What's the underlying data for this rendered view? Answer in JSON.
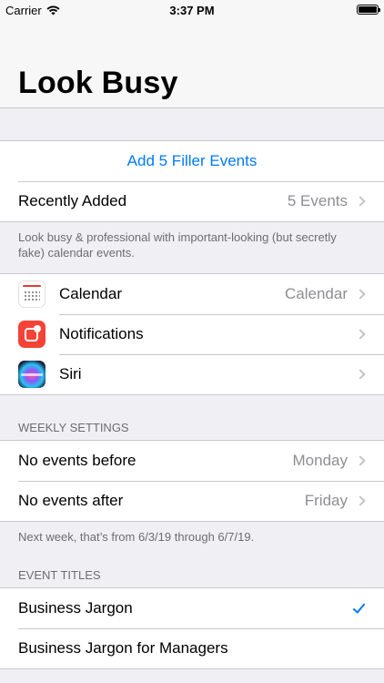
{
  "status": {
    "carrier": "Carrier",
    "time": "3:37 PM"
  },
  "nav": {
    "title": "Look Busy"
  },
  "main_group": {
    "add_action": "Add 5 Filler Events",
    "recent_label": "Recently Added",
    "recent_value": "5 Events"
  },
  "main_footer": "Look busy & professional with important-looking (but secretly fake) calendar events.",
  "apps_group": {
    "items": [
      {
        "label": "Calendar",
        "value": "Calendar"
      },
      {
        "label": "Notifications",
        "value": ""
      },
      {
        "label": "Siri",
        "value": ""
      }
    ]
  },
  "weekly": {
    "header": "WEEKLY SETTINGS",
    "before_label": "No events before",
    "before_value": "Monday",
    "after_label": "No events after",
    "after_value": "Friday",
    "footer": "Next week, that’s from 6/3/19 through 6/7/19."
  },
  "titles": {
    "header": "EVENT TITLES",
    "items": [
      {
        "label": "Business Jargon"
      },
      {
        "label": "Business Jargon for Managers"
      }
    ]
  },
  "colors": {
    "accent": "#007aff",
    "background": "#efeff4"
  }
}
